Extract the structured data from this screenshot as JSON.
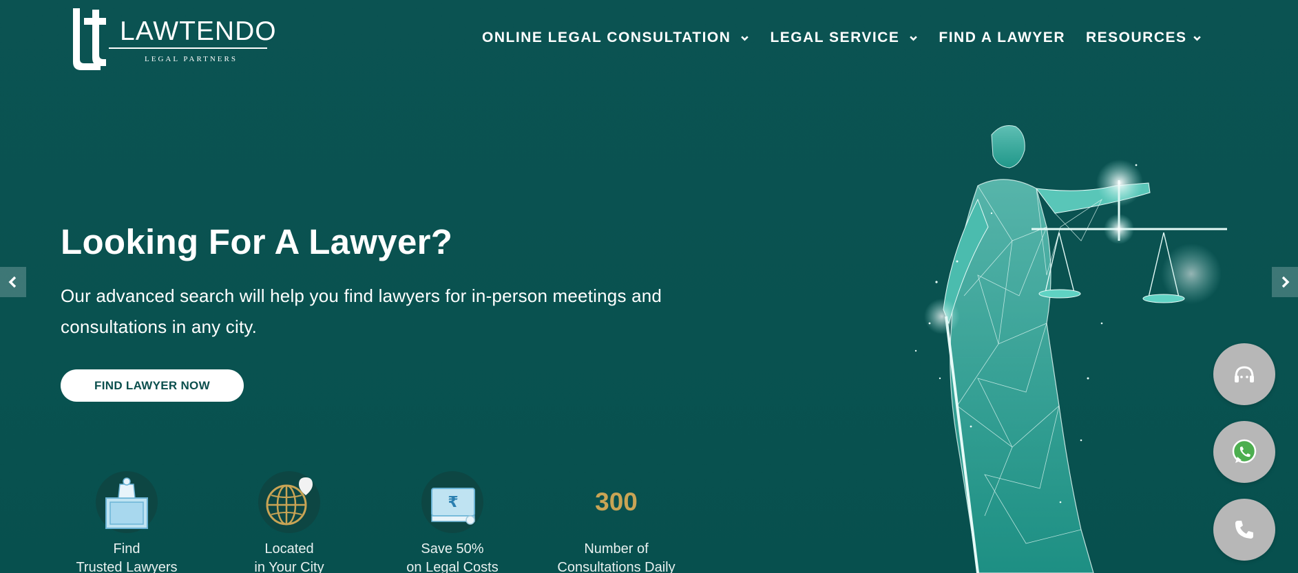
{
  "brand": {
    "name": "LAWTENDO",
    "tagline": "LEGAL PARTNERS",
    "logo_icon": "lt-monogram-logo"
  },
  "nav": {
    "items": [
      {
        "label": "ONLINE LEGAL CONSULTATION",
        "has_dropdown": true
      },
      {
        "label": "LEGAL SERVICE",
        "has_dropdown": true
      },
      {
        "label": "FIND A LAWYER",
        "has_dropdown": false
      },
      {
        "label": "RESOURCES",
        "has_dropdown": true
      }
    ]
  },
  "hero": {
    "title": "Looking For A Lawyer?",
    "subtitle": "Our advanced search will help you find lawyers for in-person meetings and consultations in any city.",
    "cta_label": "FIND LAWYER NOW",
    "image_icon": "lady-justice-scales-illustration"
  },
  "features": [
    {
      "icon": "lawyer-desk-icon",
      "line1": "Find",
      "line2": "Trusted Lawyers"
    },
    {
      "icon": "globe-pin-icon",
      "line1": "Located",
      "line2": "in Your City"
    },
    {
      "icon": "rupee-bill-icon",
      "line1": "Save 50%",
      "line2": "on Legal Costs"
    },
    {
      "number": "300",
      "line1": "Number of",
      "line2": "Consultations Daily"
    }
  ],
  "slider": {
    "prev_icon": "chevron-left-icon",
    "next_icon": "chevron-right-icon"
  },
  "fabs": [
    {
      "icon": "support-headset-icon"
    },
    {
      "icon": "whatsapp-icon"
    },
    {
      "icon": "phone-icon"
    }
  ],
  "colors": {
    "background": "#0a5250",
    "accent_gold": "#c9a455",
    "cta_text": "#0b4f4d",
    "fab_bg": "#b7b7b7",
    "whatsapp_green": "#4cae4f"
  }
}
